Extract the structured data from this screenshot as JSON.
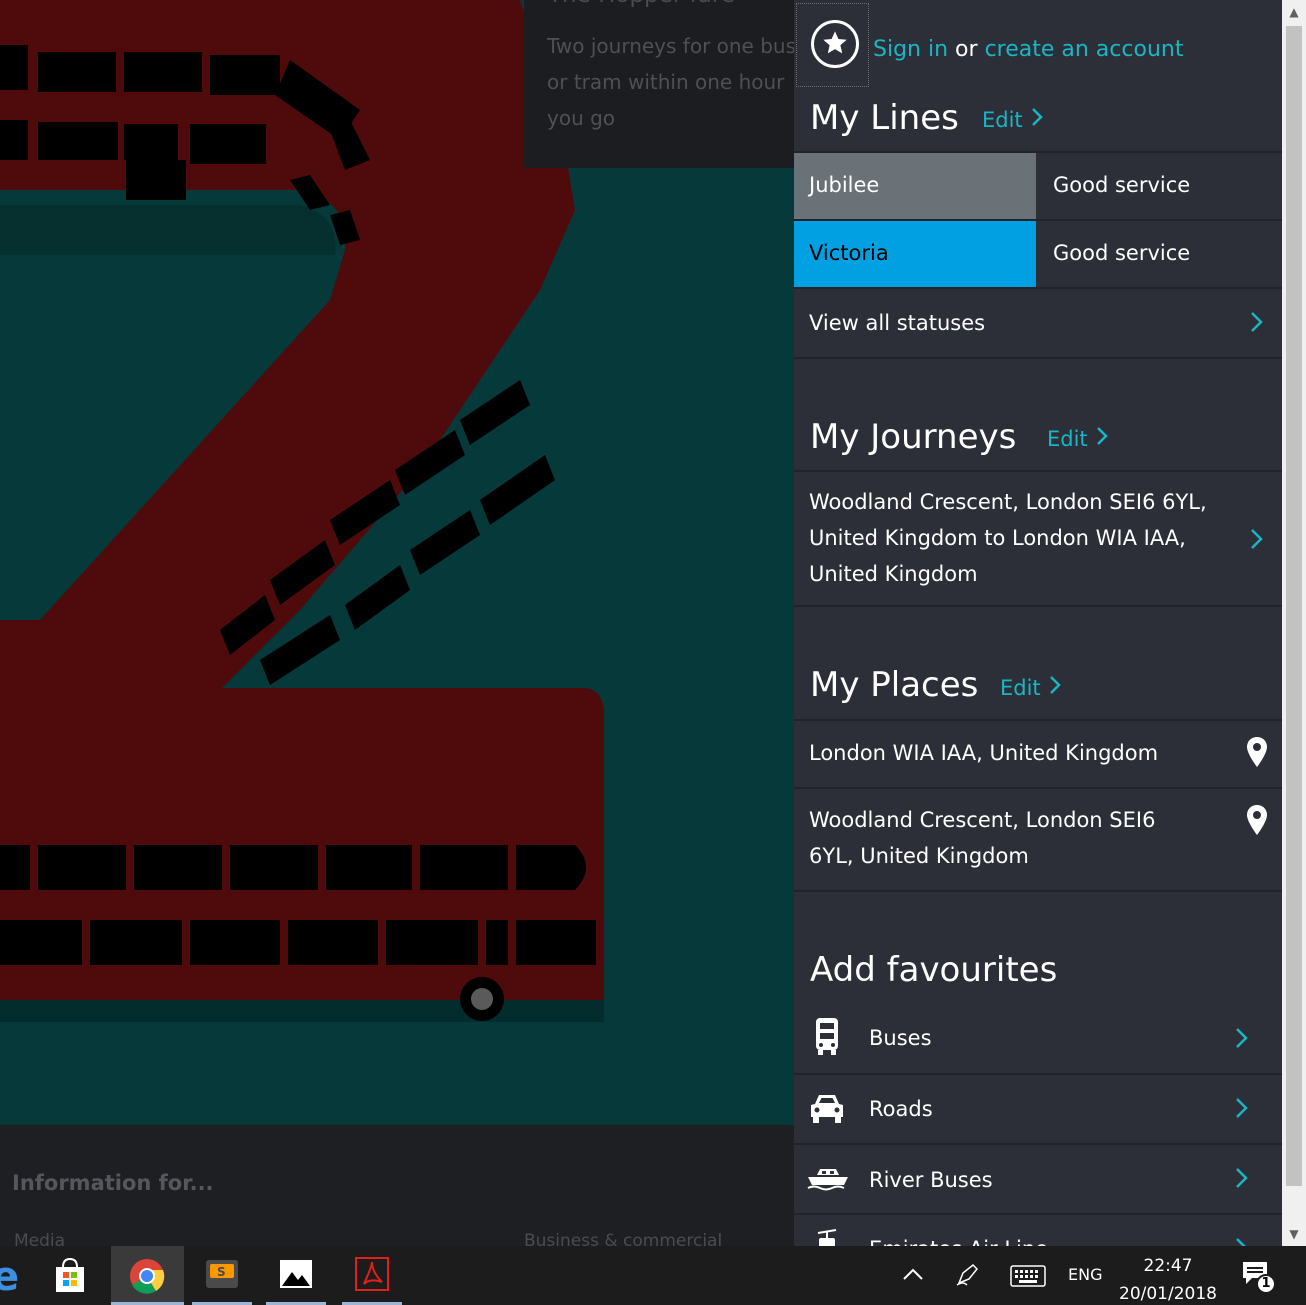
{
  "background_page": {
    "hopper_title": "The Hopper fare",
    "hopper_text": "Two journeys for one bus or tram within one hour you go",
    "footer_title": "Information for...",
    "footer_links": [
      "Media",
      "Business & commercial"
    ]
  },
  "panel": {
    "signin": {
      "sign_in": "Sign in",
      "or": "or",
      "create_account": "create an account"
    },
    "my_lines": {
      "title": "My Lines",
      "edit": "Edit",
      "lines": [
        {
          "name": "Jubilee",
          "status": "Good service",
          "color": "#6a7278"
        },
        {
          "name": "Victoria",
          "status": "Good service",
          "color": "#00a0e2"
        }
      ],
      "view_all": "View all statuses"
    },
    "my_journeys": {
      "title": "My Journeys",
      "edit": "Edit",
      "journey_lines": [
        "Woodland Crescent, London SEI6 6YL,",
        "United Kingdom to London WIA IAA,",
        "United Kingdom"
      ]
    },
    "my_places": {
      "title": "My Places",
      "edit": "Edit",
      "place1": "London WIA IAA, United Kingdom",
      "place2_lines": [
        "Woodland Crescent, London SEI6",
        "6YL, United Kingdom"
      ]
    },
    "add_favourites": {
      "title": "Add favourites",
      "items": [
        {
          "label": "Buses",
          "icon": "bus-icon"
        },
        {
          "label": "Roads",
          "icon": "car-icon"
        },
        {
          "label": "River Buses",
          "icon": "boat-icon"
        },
        {
          "label": "Emirates Air Line",
          "icon": "cable-car-icon"
        }
      ]
    }
  },
  "taskbar": {
    "language": "ENG",
    "time": "22:47",
    "date": "20/01/2018",
    "notification_count": "1"
  },
  "colors": {
    "accent": "#19b6c5",
    "panel_bg": "#2c2f38",
    "jubilee": "#6a7278",
    "victoria": "#00a0e2"
  }
}
